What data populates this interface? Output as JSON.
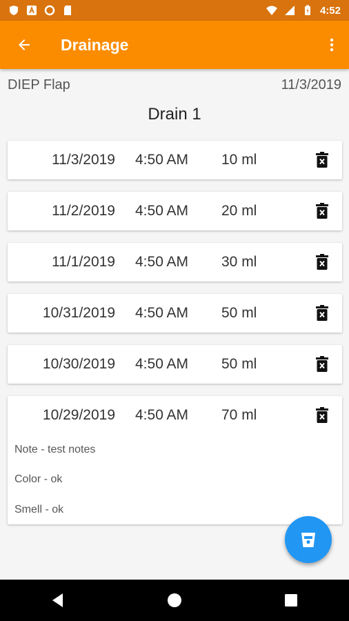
{
  "status_bar": {
    "time": "4:52",
    "icons": [
      "shield-icon",
      "a-box-icon",
      "circle-icon",
      "sd-card-icon",
      "wifi-icon",
      "signal-icon",
      "battery-icon"
    ]
  },
  "app_bar": {
    "title": "Drainage",
    "back_icon": "arrow-left-icon",
    "menu_icon": "more-vert-icon"
  },
  "header": {
    "procedure": "DIEP Flap",
    "date": "11/3/2019",
    "drain_title": "Drain 1"
  },
  "entries": [
    {
      "date": "11/3/2019",
      "time": "4:50 AM",
      "amount": "10 ml",
      "notes": []
    },
    {
      "date": "11/2/2019",
      "time": "4:50 AM",
      "amount": "20 ml",
      "notes": []
    },
    {
      "date": "11/1/2019",
      "time": "4:50 AM",
      "amount": "30 ml",
      "notes": []
    },
    {
      "date": "10/31/2019",
      "time": "4:50 AM",
      "amount": "50 ml",
      "notes": []
    },
    {
      "date": "10/30/2019",
      "time": "4:50 AM",
      "amount": "50 ml",
      "notes": []
    },
    {
      "date": "10/29/2019",
      "time": "4:50 AM",
      "amount": "70 ml",
      "notes": [
        "Note - test notes",
        "Color - ok",
        "Smell - ok"
      ]
    }
  ],
  "fab": {
    "icon": "cup-icon"
  },
  "colors": {
    "status_bar": "#d9730d",
    "app_bar": "#fb8c00",
    "fab": "#2196f3",
    "background": "#f5f5f5"
  }
}
